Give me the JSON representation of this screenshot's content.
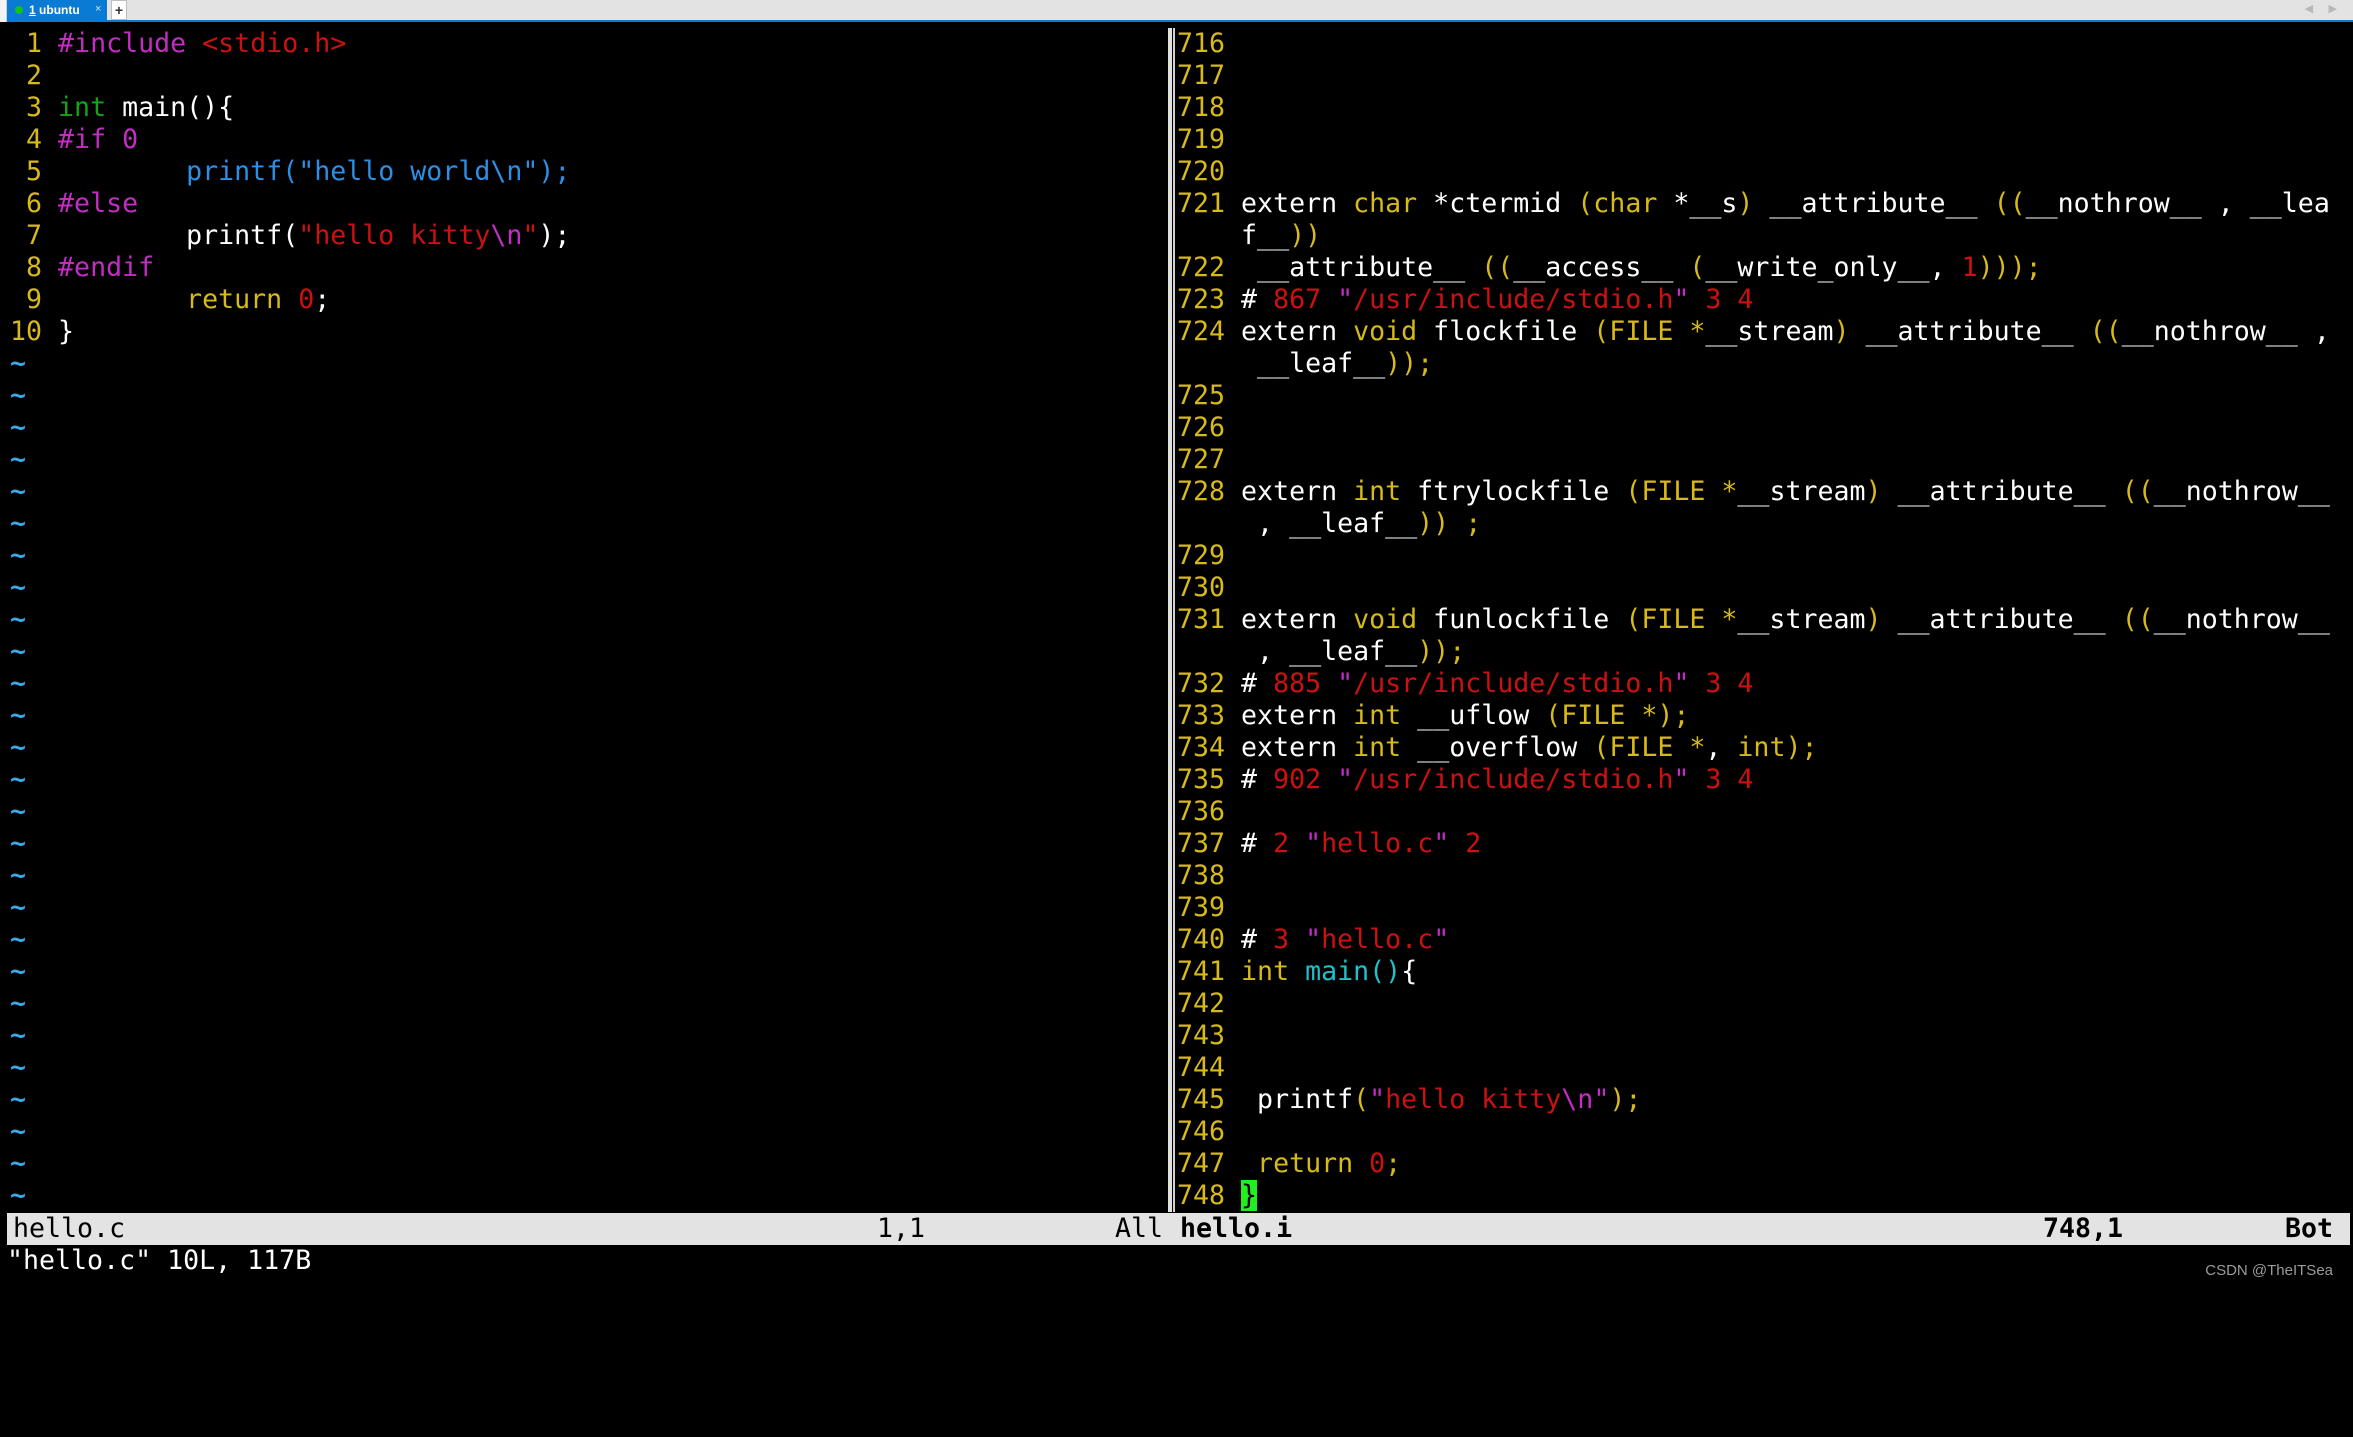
{
  "tabbar": {
    "tab": {
      "index": "1",
      "label": "ubuntu",
      "status_color": "#12c21a",
      "close_glyph": "×"
    },
    "new_tab_glyph": "+",
    "nav_glyphs": "◀ ▶"
  },
  "left_pane": {
    "lines": [
      {
        "n": " 1",
        "tokens": [
          {
            "t": "#include",
            "c": "mag"
          },
          {
            "t": " ",
            "c": ""
          },
          {
            "t": "<stdio.h>",
            "c": "red"
          }
        ]
      },
      {
        "n": " 2",
        "tokens": []
      },
      {
        "n": " 3",
        "tokens": [
          {
            "t": "int",
            "c": "type"
          },
          {
            "t": " main(){",
            "c": ""
          }
        ]
      },
      {
        "n": " 4",
        "tokens": [
          {
            "t": "#if 0",
            "c": "mag"
          }
        ]
      },
      {
        "n": " 5",
        "tokens": [
          {
            "t": "        printf(\"hello world\\n\");",
            "c": "blue"
          }
        ]
      },
      {
        "n": " 6",
        "tokens": [
          {
            "t": "#else",
            "c": "mag"
          }
        ]
      },
      {
        "n": " 7",
        "tokens": [
          {
            "t": "        printf(",
            "c": ""
          },
          {
            "t": "\"",
            "c": "red"
          },
          {
            "t": "hello kitty",
            "c": "red"
          },
          {
            "t": "\\n",
            "c": "mag"
          },
          {
            "t": "\"",
            "c": "red"
          },
          {
            "t": ");",
            "c": ""
          }
        ]
      },
      {
        "n": " 8",
        "tokens": [
          {
            "t": "#endif",
            "c": "mag"
          }
        ]
      },
      {
        "n": " 9",
        "tokens": [
          {
            "t": "        return",
            "c": "yel"
          },
          {
            "t": " ",
            "c": ""
          },
          {
            "t": "0",
            "c": "red"
          },
          {
            "t": ";",
            "c": ""
          }
        ]
      },
      {
        "n": "10",
        "tokens": [
          {
            "t": "}",
            "c": ""
          }
        ]
      }
    ],
    "tilde_rows": 27,
    "tilde": "~"
  },
  "right_pane": {
    "rows": [
      {
        "n": "716",
        "tokens": []
      },
      {
        "n": "717",
        "tokens": []
      },
      {
        "n": "718",
        "tokens": []
      },
      {
        "n": "719",
        "tokens": []
      },
      {
        "n": "720",
        "tokens": []
      },
      {
        "n": "721",
        "tokens": [
          {
            "t": "extern ",
            "c": ""
          },
          {
            "t": "char",
            "c": "yel"
          },
          {
            "t": " *ctermid ",
            "c": ""
          },
          {
            "t": "(char",
            "c": "yel"
          },
          {
            "t": " *__s",
            "c": ""
          },
          {
            "t": ")",
            "c": "yel"
          },
          {
            "t": " __attribute__ ",
            "c": ""
          },
          {
            "t": "((",
            "c": "yel"
          },
          {
            "t": "__nothrow__ , __lea",
            "c": ""
          }
        ]
      },
      {
        "n": "",
        "tokens": [
          {
            "t": "f__",
            "c": ""
          },
          {
            "t": "))",
            "c": "yel"
          }
        ]
      },
      {
        "n": "722",
        "tokens": [
          {
            "t": " __attribute__ ",
            "c": ""
          },
          {
            "t": "((",
            "c": "yel"
          },
          {
            "t": "__access__ ",
            "c": ""
          },
          {
            "t": "(",
            "c": "yel"
          },
          {
            "t": "__write_only__, ",
            "c": ""
          },
          {
            "t": "1",
            "c": "red"
          },
          {
            "t": ")));",
            "c": "yel"
          }
        ]
      },
      {
        "n": "723",
        "tokens": [
          {
            "t": "# ",
            "c": ""
          },
          {
            "t": "867 ",
            "c": "red"
          },
          {
            "t": "\"",
            "c": "mag"
          },
          {
            "t": "/usr/include/stdio.h",
            "c": "red"
          },
          {
            "t": "\"",
            "c": "mag"
          },
          {
            "t": " 3 4",
            "c": "red"
          }
        ]
      },
      {
        "n": "724",
        "tokens": [
          {
            "t": "extern ",
            "c": ""
          },
          {
            "t": "void",
            "c": "yel"
          },
          {
            "t": " flockfile ",
            "c": ""
          },
          {
            "t": "(FILE",
            "c": "yel"
          },
          {
            "t": " ",
            "c": ""
          },
          {
            "t": "*",
            "c": "yel"
          },
          {
            "t": "__stream",
            "c": ""
          },
          {
            "t": ")",
            "c": "yel"
          },
          {
            "t": " __attribute__ ",
            "c": ""
          },
          {
            "t": "((",
            "c": "yel"
          },
          {
            "t": "__nothrow__ ,",
            "c": ""
          }
        ]
      },
      {
        "n": "",
        "tokens": [
          {
            "t": " __leaf__",
            "c": ""
          },
          {
            "t": "));",
            "c": "yel"
          }
        ]
      },
      {
        "n": "725",
        "tokens": []
      },
      {
        "n": "726",
        "tokens": []
      },
      {
        "n": "727",
        "tokens": []
      },
      {
        "n": "728",
        "tokens": [
          {
            "t": "extern ",
            "c": ""
          },
          {
            "t": "int",
            "c": "yel"
          },
          {
            "t": " ftrylockfile ",
            "c": ""
          },
          {
            "t": "(FILE",
            "c": "yel"
          },
          {
            "t": " ",
            "c": ""
          },
          {
            "t": "*",
            "c": "yel"
          },
          {
            "t": "__stream",
            "c": ""
          },
          {
            "t": ")",
            "c": "yel"
          },
          {
            "t": " __attribute__ ",
            "c": ""
          },
          {
            "t": "((",
            "c": "yel"
          },
          {
            "t": "__nothrow__",
            "c": ""
          }
        ]
      },
      {
        "n": "",
        "tokens": [
          {
            "t": " , __leaf__",
            "c": ""
          },
          {
            "t": ")) ;",
            "c": "yel"
          }
        ]
      },
      {
        "n": "729",
        "tokens": []
      },
      {
        "n": "730",
        "tokens": []
      },
      {
        "n": "731",
        "tokens": [
          {
            "t": "extern ",
            "c": ""
          },
          {
            "t": "void",
            "c": "yel"
          },
          {
            "t": " funlockfile ",
            "c": ""
          },
          {
            "t": "(FILE",
            "c": "yel"
          },
          {
            "t": " ",
            "c": ""
          },
          {
            "t": "*",
            "c": "yel"
          },
          {
            "t": "__stream",
            "c": ""
          },
          {
            "t": ")",
            "c": "yel"
          },
          {
            "t": " __attribute__ ",
            "c": ""
          },
          {
            "t": "((",
            "c": "yel"
          },
          {
            "t": "__nothrow__",
            "c": ""
          }
        ]
      },
      {
        "n": "",
        "tokens": [
          {
            "t": " , __leaf__",
            "c": ""
          },
          {
            "t": "));",
            "c": "yel"
          }
        ]
      },
      {
        "n": "732",
        "tokens": [
          {
            "t": "# ",
            "c": ""
          },
          {
            "t": "885 ",
            "c": "red"
          },
          {
            "t": "\"",
            "c": "mag"
          },
          {
            "t": "/usr/include/stdio.h",
            "c": "red"
          },
          {
            "t": "\"",
            "c": "mag"
          },
          {
            "t": " 3 4",
            "c": "red"
          }
        ]
      },
      {
        "n": "733",
        "tokens": [
          {
            "t": "extern ",
            "c": ""
          },
          {
            "t": "int",
            "c": "yel"
          },
          {
            "t": " __uflow ",
            "c": ""
          },
          {
            "t": "(FILE *);",
            "c": "yel"
          }
        ]
      },
      {
        "n": "734",
        "tokens": [
          {
            "t": "extern ",
            "c": ""
          },
          {
            "t": "int",
            "c": "yel"
          },
          {
            "t": " __overflow ",
            "c": ""
          },
          {
            "t": "(FILE *",
            "c": "yel"
          },
          {
            "t": ", ",
            "c": ""
          },
          {
            "t": "int);",
            "c": "yel"
          }
        ]
      },
      {
        "n": "735",
        "tokens": [
          {
            "t": "# ",
            "c": ""
          },
          {
            "t": "902 ",
            "c": "red"
          },
          {
            "t": "\"",
            "c": "mag"
          },
          {
            "t": "/usr/include/stdio.h",
            "c": "red"
          },
          {
            "t": "\"",
            "c": "mag"
          },
          {
            "t": " 3 4",
            "c": "red"
          }
        ]
      },
      {
        "n": "736",
        "tokens": []
      },
      {
        "n": "737",
        "tokens": [
          {
            "t": "# ",
            "c": ""
          },
          {
            "t": "2 ",
            "c": "red"
          },
          {
            "t": "\"",
            "c": "mag"
          },
          {
            "t": "hello.c",
            "c": "red"
          },
          {
            "t": "\"",
            "c": "mag"
          },
          {
            "t": " 2",
            "c": "red"
          }
        ]
      },
      {
        "n": "738",
        "tokens": []
      },
      {
        "n": "739",
        "tokens": []
      },
      {
        "n": "740",
        "tokens": [
          {
            "t": "# ",
            "c": ""
          },
          {
            "t": "3 ",
            "c": "red"
          },
          {
            "t": "\"",
            "c": "mag"
          },
          {
            "t": "hello.c",
            "c": "red"
          },
          {
            "t": "\"",
            "c": "mag"
          }
        ]
      },
      {
        "n": "741",
        "tokens": [
          {
            "t": "int",
            "c": "yel"
          },
          {
            "t": " ",
            "c": ""
          },
          {
            "t": "main()",
            "c": "cyan"
          },
          {
            "t": "{",
            "c": ""
          }
        ]
      },
      {
        "n": "742",
        "tokens": []
      },
      {
        "n": "743",
        "tokens": []
      },
      {
        "n": "744",
        "tokens": []
      },
      {
        "n": "745",
        "tokens": [
          {
            "t": " printf",
            "c": ""
          },
          {
            "t": "(",
            "c": "yel"
          },
          {
            "t": "\"",
            "c": "mag"
          },
          {
            "t": "hello kitty",
            "c": "red"
          },
          {
            "t": "\\n",
            "c": "mag"
          },
          {
            "t": "\"",
            "c": "mag"
          },
          {
            "t": ");",
            "c": "yel"
          }
        ]
      },
      {
        "n": "746",
        "tokens": []
      },
      {
        "n": "747",
        "tokens": [
          {
            "t": " return",
            "c": "yel"
          },
          {
            "t": " ",
            "c": ""
          },
          {
            "t": "0",
            "c": "red"
          },
          {
            "t": ";",
            "c": "yel"
          }
        ]
      },
      {
        "n": "748",
        "tokens": [
          {
            "t": "}",
            "c": "cursor"
          }
        ]
      }
    ]
  },
  "statusline": {
    "left_file": "hello.c",
    "left_pos": "1,1",
    "left_scroll": "All",
    "right_file": "hello.i",
    "right_pos": "748,1",
    "right_scroll": "Bot"
  },
  "cmdline": "\"hello.c\" 10L, 117B",
  "watermark": "CSDN @TheITSea",
  "colors": {
    "accent": "#0a7bd4",
    "cursor": "#22ee22",
    "linenr": "#d7b91a"
  }
}
